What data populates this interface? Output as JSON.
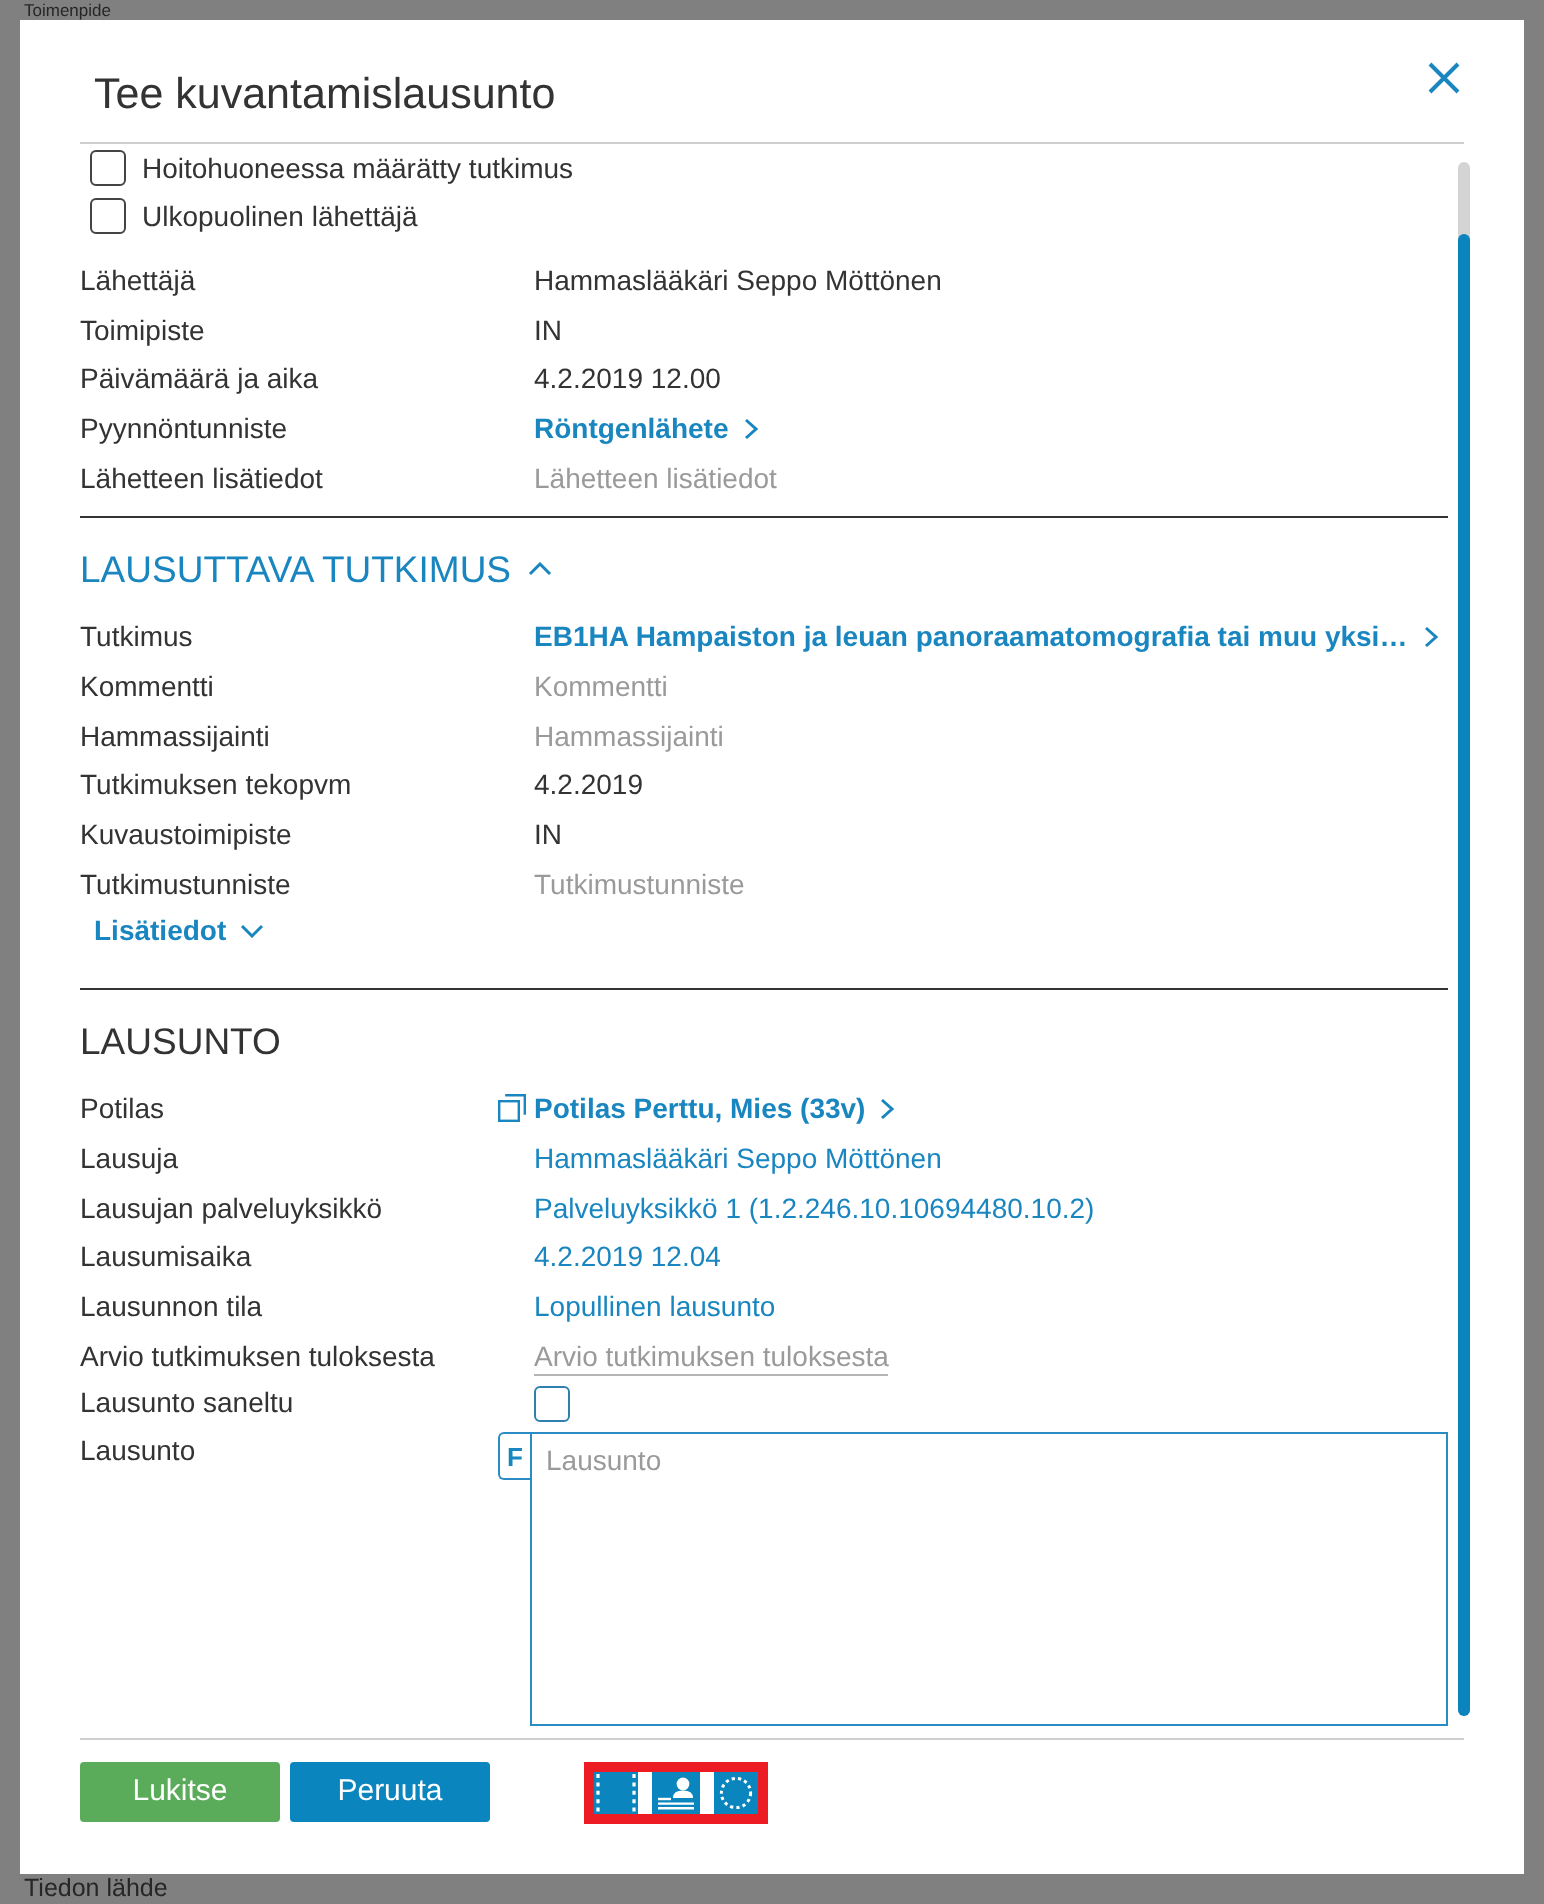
{
  "background_page": {
    "heading": "Toimenpide",
    "label": "Tiedon lähde"
  },
  "dialog": {
    "title": "Tee kuvantamislausunto"
  },
  "checkboxes": [
    {
      "label": "Hoitohuoneessa määrätty tutkimus",
      "checked": false
    },
    {
      "label": "Ulkopuolinen lähettäjä",
      "checked": false
    }
  ],
  "referral_fields": [
    {
      "kind": "text",
      "label": "Lähettäjä",
      "value": "Hammaslääkäri Seppo Möttönen"
    },
    {
      "kind": "text",
      "label": "Toimipiste",
      "value": "IN"
    },
    {
      "kind": "text",
      "label": "Päivämäärä ja aika",
      "value": "4.2.2019 12.00"
    },
    {
      "kind": "link",
      "label": "Pyynnöntunniste",
      "value": "Röntgenlähete"
    },
    {
      "kind": "empty_field",
      "label": "Lähetteen lisätiedot",
      "placeholder": "Lähetteen lisätiedot"
    }
  ],
  "study_section": {
    "heading": "LAUSUTTAVA TUTKIMUS",
    "expanded": true,
    "fields": [
      {
        "kind": "link",
        "label": "Tutkimus",
        "value": "EB1HA Hampaiston ja leuan panoraamatomografia tai muu yksi…"
      },
      {
        "kind": "empty_field",
        "label": "Kommentti",
        "placeholder": "Kommentti"
      },
      {
        "kind": "empty_field",
        "label": "Hammassijainti",
        "placeholder": "Hammassijainti"
      },
      {
        "kind": "text",
        "label": "Tutkimuksen tekopvm",
        "value": "4.2.2019"
      },
      {
        "kind": "text",
        "label": "Kuvaustoimipiste",
        "value": "IN"
      },
      {
        "kind": "empty_field",
        "label": "Tutkimustunniste",
        "placeholder": "Tutkimustunniste"
      }
    ],
    "more": {
      "label": "Lisätiedot",
      "expanded": false
    }
  },
  "statement_section": {
    "heading": "LAUSUNTO",
    "fields": [
      {
        "kind": "patient_link",
        "label": "Potilas",
        "value": "Potilas Perttu, Mies (33v)"
      },
      {
        "kind": "selectable",
        "label": "Lausuja",
        "value": "Hammaslääkäri Seppo Möttönen"
      },
      {
        "kind": "selectable",
        "label": "Lausujan palveluyksikkö",
        "value": "Palveluyksikkö 1 (1.2.246.10.10694480.10.2)"
      },
      {
        "kind": "selectable",
        "label": "Lausumisaika",
        "value": "4.2.2019 12.04"
      },
      {
        "kind": "selectable",
        "label": "Lausunnon tila",
        "value": "Lopullinen lausunto"
      },
      {
        "kind": "underlined_field",
        "label": "Arvio tutkimuksen tuloksesta",
        "placeholder": "Arvio tutkimuksen tuloksesta"
      },
      {
        "kind": "checkbox",
        "label": "Lausunto saneltu",
        "checked": false
      },
      {
        "kind": "textarea",
        "label": "Lausunto",
        "placeholder": "Lausunto",
        "format_tab": "F"
      }
    ]
  },
  "buttons": [
    {
      "kind": "confirm",
      "label": "Lukitse"
    },
    {
      "kind": "cancel",
      "label": "Peruuta"
    }
  ]
}
